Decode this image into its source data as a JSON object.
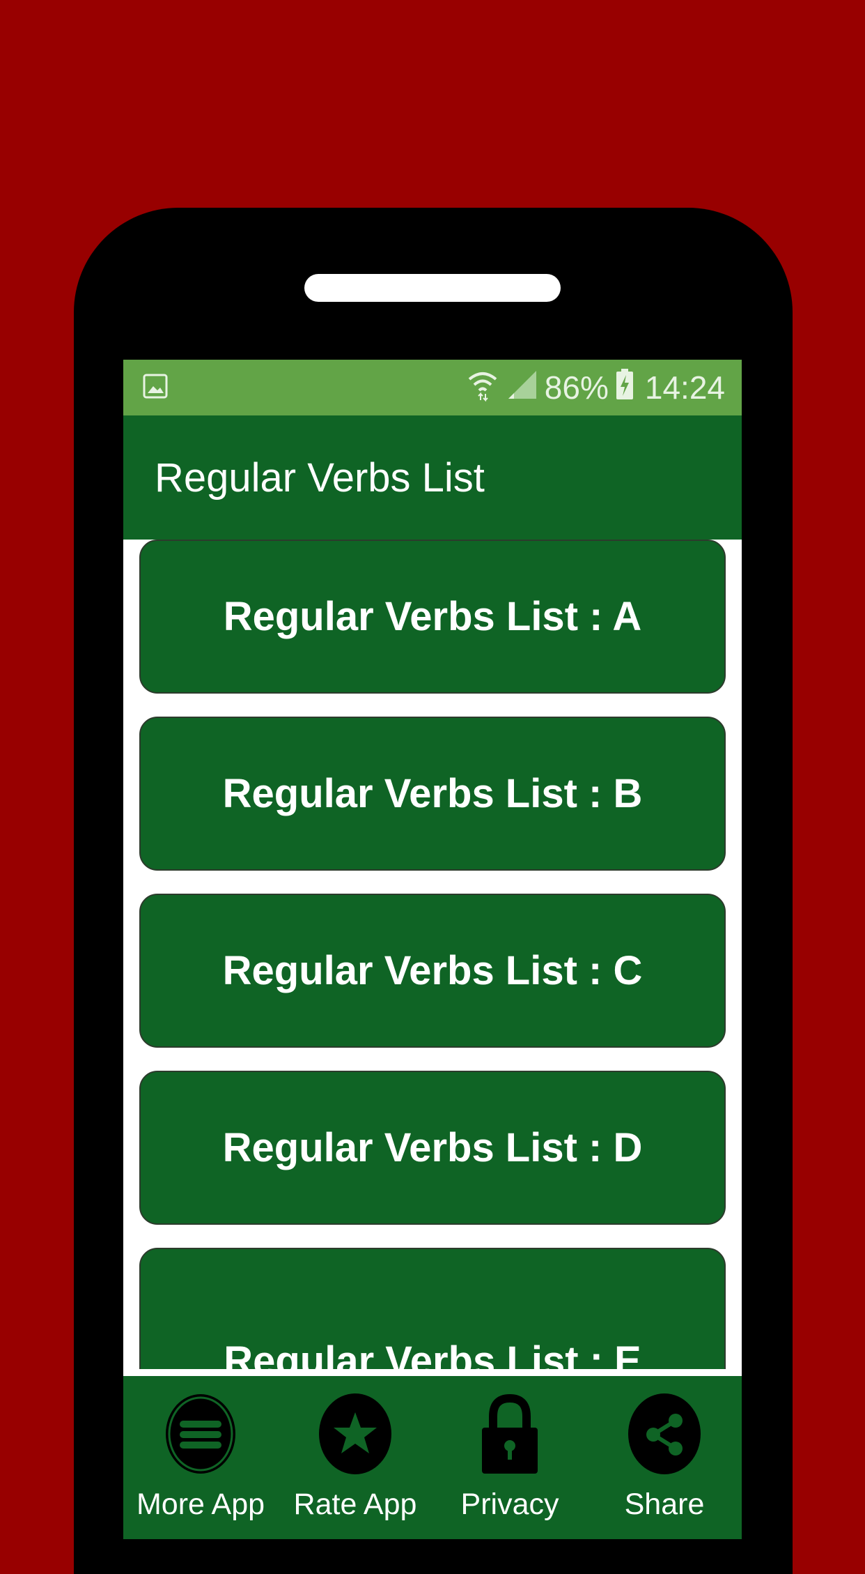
{
  "status": {
    "battery": "86%",
    "time": "14:24"
  },
  "appbar": {
    "title": "Regular Verbs List"
  },
  "list": {
    "items": [
      {
        "label": "Regular Verbs List : A"
      },
      {
        "label": "Regular Verbs List : B"
      },
      {
        "label": "Regular Verbs List : C"
      },
      {
        "label": "Regular Verbs List : D"
      },
      {
        "label": "Regular Verbs List : E"
      }
    ]
  },
  "bottom_nav": [
    {
      "label": "More App",
      "icon": "menu-icon"
    },
    {
      "label": "Rate App",
      "icon": "star-icon"
    },
    {
      "label": "Privacy",
      "icon": "lock-icon"
    },
    {
      "label": "Share",
      "icon": "share-icon"
    }
  ],
  "colors": {
    "background": "#980000",
    "status_bar": "#62a447",
    "primary": "#0f6425"
  }
}
